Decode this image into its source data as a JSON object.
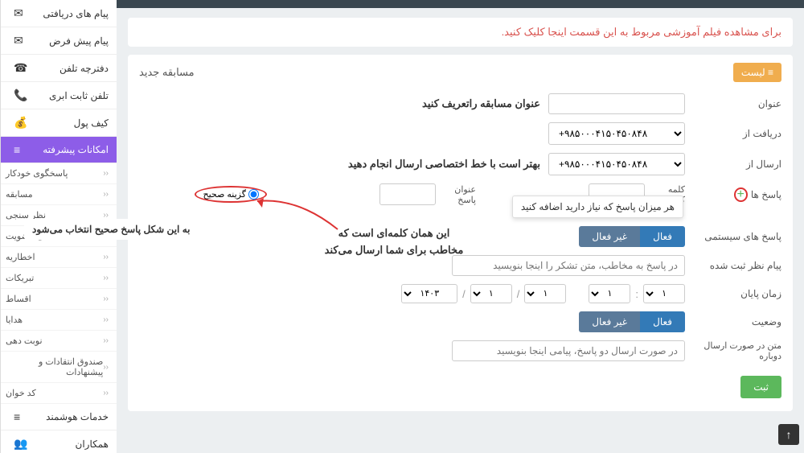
{
  "sidebar": {
    "items": [
      {
        "label": "پیام های دریافتی",
        "icon": "✉"
      },
      {
        "label": "پیام پیش فرض",
        "icon": "✉"
      },
      {
        "label": "دفترچه تلفن",
        "icon": "☎"
      },
      {
        "label": "تلفن ثابت ابری",
        "icon": "📞"
      },
      {
        "label": "کیف پول",
        "icon": "💰"
      }
    ],
    "active": {
      "label": "امکانات پیشرفته",
      "icon": "≡"
    },
    "subs": [
      "پاسخگوی خودکار",
      "مسابقه",
      "نظر سنجی",
      "منشی عضویت",
      "اخطاریه",
      "تبریکات",
      "اقساط",
      "هدایا",
      "نوبت دهی",
      "صندوق انتقادات و پیشنهادات",
      "کد خوان"
    ],
    "footer": [
      {
        "label": "خدمات هوشمند",
        "icon": "≡"
      },
      {
        "label": "همکاران",
        "icon": "👥"
      }
    ]
  },
  "notice": "برای مشاهده فیلم آموزشی مربوط به این قسمت اینجا کلیک کنید.",
  "panel": {
    "title": "مسابقه جدید",
    "list_btn": "≡ لیست"
  },
  "form": {
    "title_label": "عنوان",
    "title_hint": "عنوان مسابقه راتعریف کنید",
    "receive_label": "دریافت از",
    "receive_value": "+۹۸۵۰۰۰۴۱۵۰۴۵۰۸۴۸",
    "send_label": "ارسال از",
    "send_value": "+۹۸۵۰۰۰۴۱۵۰۴۵۰۸۴۸",
    "send_hint": "بهتر است با خط اختصاصی ارسال انجام دهید",
    "answers_label": "پاسخ ها",
    "keyword_label": "کلمه کلیدی",
    "answer_title_label": "عنوان پاسخ",
    "correct_label": "گزینه صحیح",
    "sys_answers_label": "پاسخ های سیستمی",
    "active_btn": "فعال",
    "inactive_btn": "غیر فعال",
    "registered_label": "پیام نظر ثبت شده",
    "registered_placeholder": "در پاسخ به مخاطب، متن تشکر را اینجا بنویسید",
    "endtime_label": "زمان پایان",
    "date": {
      "y": "۱۴۰۳",
      "m": "۱",
      "d": "۱",
      "h": "۱",
      "min": "۱"
    },
    "status_label": "وضعیت",
    "resend_label": "متن در صورت ارسال دوباره",
    "resend_placeholder": "در صورت ارسال دو پاسخ، پیامی اینجا بنویسید",
    "submit": "ثبت"
  },
  "callouts": {
    "c1": "هر میزان پاسخ که نیاز دارید اضافه کنید",
    "c2": "به این شکل پاسخ صحیح انتخاب می‌شود",
    "c3a": "این همان کلمه‌ای است که",
    "c3b": "مخاطب برای شما ارسال می‌کند"
  }
}
